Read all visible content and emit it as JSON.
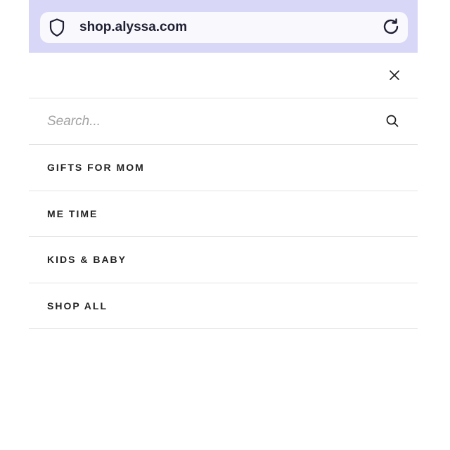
{
  "browser": {
    "url": "shop.alyssa.com",
    "icons": {
      "security": "shield-icon",
      "reload": "reload-icon"
    }
  },
  "menu": {
    "close_icon": "close-icon",
    "search": {
      "placeholder": "Search...",
      "icon": "search-icon"
    },
    "items": [
      {
        "label": "GIFTS FOR MOM"
      },
      {
        "label": "ME TIME"
      },
      {
        "label": "KIDS & BABY"
      },
      {
        "label": "SHOP ALL"
      }
    ]
  },
  "colors": {
    "browser_bar": "#d9d7f8",
    "url_pill": "#f8f8fd",
    "text": "#222222",
    "placeholder": "#a3a3a3",
    "divider": "#e3e3e3"
  }
}
